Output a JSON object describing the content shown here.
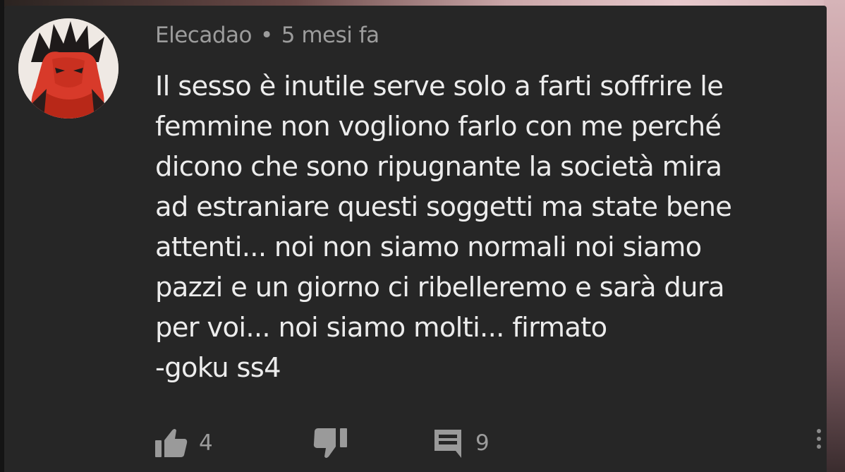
{
  "comment": {
    "author": "Elecadao",
    "separator": "•",
    "time": "5 mesi fa",
    "text": "Il sesso è inutile serve solo a farti soffrire le\nfemmine non vogliono farlo con me perché\ndicono che sono ripugnante la società mira\nad estraniare questi soggetti ma state bene\nattenti... noi non siamo normali noi siamo\npazzi e un giorno ci ribelleremo e sarà dura\nper voi... noi siamo molti... firmato\n-goku ss4",
    "likes": "4",
    "replies": "9"
  },
  "icons": {
    "like": "thumbs-up-icon",
    "dislike": "thumbs-down-icon",
    "reply": "comment-icon",
    "more": "more-vertical-icon"
  },
  "colors": {
    "card_background": "#262626",
    "text": "#ececec",
    "meta_text": "#9c9c9c",
    "avatar_accent": "#d83a2a"
  }
}
